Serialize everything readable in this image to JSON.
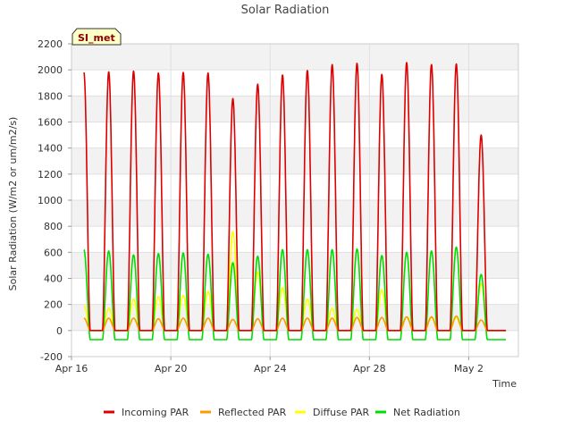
{
  "chart_data": {
    "type": "line",
    "title": "Solar Radiation",
    "xlabel": "Time",
    "ylabel": "Solar Radiation (W/m2 or um/m2/s)",
    "site_badge": "SI_met",
    "xlim_days": [
      0,
      18
    ],
    "ylim": [
      -200,
      2200
    ],
    "y_ticks": [
      -200,
      0,
      200,
      400,
      600,
      800,
      1000,
      1200,
      1400,
      1600,
      1800,
      2000,
      2200
    ],
    "x_ticks": [
      {
        "day": 0,
        "label": "Apr 16"
      },
      {
        "day": 4,
        "label": "Apr 20"
      },
      {
        "day": 8,
        "label": "Apr 24"
      },
      {
        "day": 12,
        "label": "Apr 28"
      },
      {
        "day": 16,
        "label": "May 2"
      }
    ],
    "grid": true,
    "legend_position": "bottom",
    "day_dates": [
      "Apr 16",
      "Apr 17",
      "Apr 18",
      "Apr 19",
      "Apr 20",
      "Apr 21",
      "Apr 22",
      "Apr 23",
      "Apr 24",
      "Apr 25",
      "Apr 26",
      "Apr 27",
      "Apr 28",
      "Apr 29",
      "Apr 30",
      "May 1",
      "May 2",
      "May 3"
    ],
    "series": [
      {
        "name": "Incoming PAR",
        "color": "#dd0000",
        "daily_peak": [
          1980,
          1985,
          1990,
          1975,
          1980,
          1975,
          1780,
          1890,
          1960,
          1995,
          2040,
          2050,
          1965,
          2055,
          2040,
          2045,
          1500
        ]
      },
      {
        "name": "Reflected PAR",
        "color": "#ff9900",
        "daily_peak": [
          95,
          95,
          95,
          90,
          95,
          95,
          85,
          90,
          95,
          95,
          95,
          100,
          100,
          105,
          105,
          110,
          80
        ]
      },
      {
        "name": "Diffuse PAR",
        "color": "#ffff00",
        "daily_peak": [
          190,
          170,
          240,
          260,
          270,
          300,
          760,
          450,
          330,
          240,
          170,
          160,
          310,
          100,
          100,
          100,
          360
        ]
      },
      {
        "name": "Net Radiation",
        "color": "#00dd00",
        "daily_peak": [
          620,
          610,
          580,
          590,
          595,
          585,
          520,
          570,
          620,
          620,
          620,
          625,
          575,
          600,
          610,
          640,
          430
        ],
        "night_value": -70
      }
    ]
  }
}
